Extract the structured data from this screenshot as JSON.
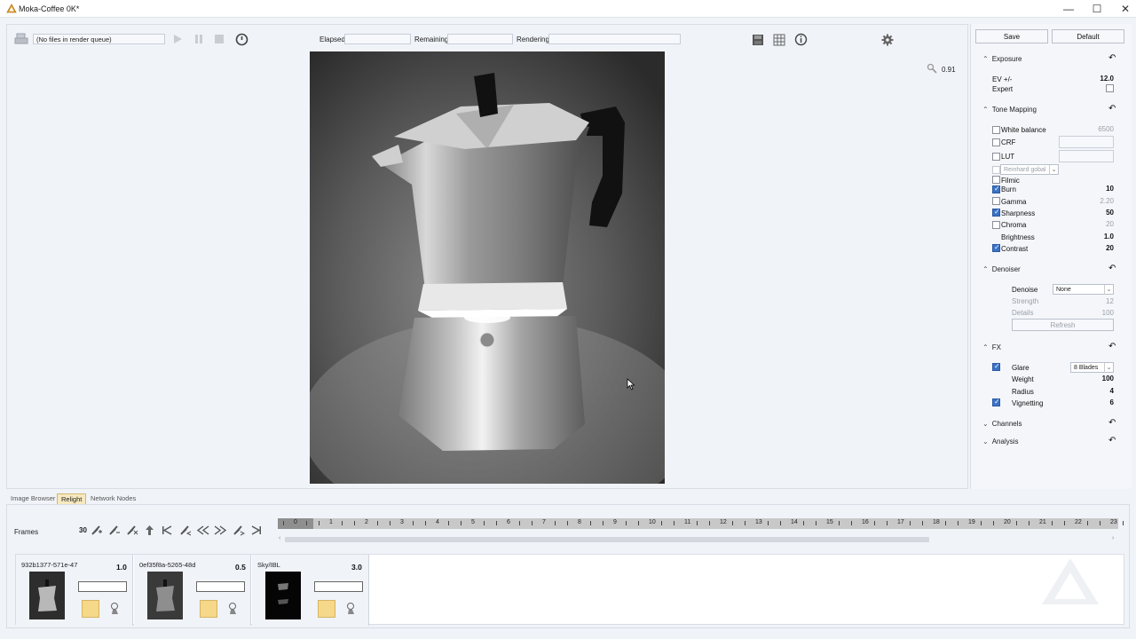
{
  "window": {
    "title": "Moka-Coffee 0K*"
  },
  "toolbar": {
    "queue_text": "(No files in render queue)",
    "elapsed_label": "Elapsed",
    "remaining_label": "Remaining",
    "rendering_label": "Rendering",
    "zoom": "0.91"
  },
  "settings": {
    "save_label": "Save",
    "default_label": "Default",
    "exposure": {
      "title": "Exposure",
      "ev_label": "EV +/-",
      "ev_value": "12.0",
      "expert_label": "Expert"
    },
    "tone_mapping": {
      "title": "Tone Mapping",
      "white_balance_label": "White balance",
      "white_balance_value": "6500",
      "crf_label": "CRF",
      "lut_label": "LUT",
      "reinhard_label": "Reinhard gobal",
      "filmic_label": "Filmic",
      "burn_label": "Burn",
      "burn_value": "10",
      "gamma_label": "Gamma",
      "gamma_value": "2.20",
      "sharpness_label": "Sharpness",
      "sharpness_value": "50",
      "chroma_label": "Chroma",
      "chroma_value": "20",
      "brightness_label": "Brightness",
      "brightness_value": "1.0",
      "contrast_label": "Contrast",
      "contrast_value": "20"
    },
    "denoiser": {
      "title": "Denoiser",
      "denoise_label": "Denoise",
      "denoise_value": "None",
      "strength_label": "Strength",
      "strength_value": "12",
      "details_label": "Details",
      "details_value": "100",
      "refresh_label": "Refresh"
    },
    "fx": {
      "title": "FX",
      "glare_label": "Glare",
      "glare_value": "8 Blades",
      "weight_label": "Weight",
      "weight_value": "100",
      "radius_label": "Radius",
      "radius_value": "4",
      "vignetting_label": "Vignetting",
      "vignetting_value": "6"
    },
    "channels": {
      "title": "Channels"
    },
    "analysis": {
      "title": "Analysis"
    }
  },
  "tabs": [
    {
      "label": "Image Browser"
    },
    {
      "label": "Relight"
    },
    {
      "label": "Network Nodes"
    }
  ],
  "frames": {
    "label": "Frames",
    "count": "30",
    "ticks": [
      "0",
      "1",
      "2",
      "3",
      "4",
      "5",
      "6",
      "7",
      "8",
      "9",
      "10",
      "11",
      "12",
      "13",
      "14",
      "15",
      "16",
      "17",
      "18",
      "19",
      "20",
      "21",
      "22",
      "23"
    ]
  },
  "lights": [
    {
      "name": "932b1377-571e-47",
      "value": "1.0"
    },
    {
      "name": "0ef35f8a-5265-48d",
      "value": "0.5"
    },
    {
      "name": "Sky/IBL",
      "value": "3.0"
    }
  ],
  "colors": {
    "accent": "#3b73c6",
    "active_tab": "#f7e9bf",
    "light_swatch": "#f5d88a"
  }
}
